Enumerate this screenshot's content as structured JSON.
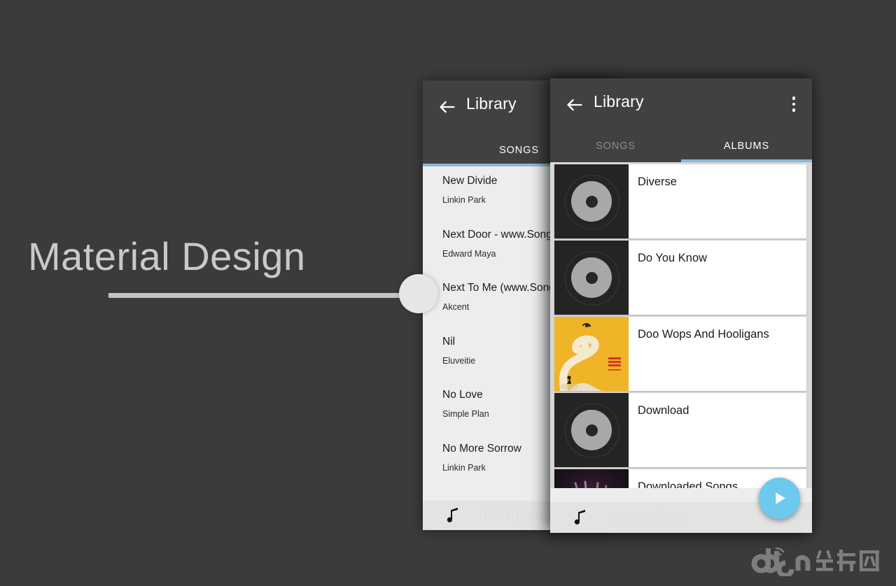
{
  "hero": {
    "title": "Material Design",
    "slider_name": "material-design-slider"
  },
  "screen_back": {
    "appbar": {
      "back_icon": "arrow-back-icon",
      "title": "Library"
    },
    "tabs": [
      {
        "label": "SONGS",
        "active": true
      }
    ],
    "songs": [
      {
        "title": "New Divide",
        "artist": "Linkin Park"
      },
      {
        "title": "Next Door - www.SongsLover",
        "artist": "Edward Maya"
      },
      {
        "title": "Next To Me (www.Songs.PK)",
        "artist": "Akcent"
      },
      {
        "title": "Nil",
        "artist": "Eluveitie"
      },
      {
        "title": "No Love",
        "artist": "Simple Plan"
      },
      {
        "title": "No More Sorrow",
        "artist": "Linkin Park"
      }
    ],
    "nowplaying": {
      "icon": "music-note-icon",
      "label": "One Step Close"
    }
  },
  "screen_front": {
    "appbar": {
      "back_icon": "arrow-back-icon",
      "title": "Library",
      "overflow_icon": "more-vertical-icon"
    },
    "tabs": [
      {
        "label": "SONGS",
        "active": false
      },
      {
        "label": "ALBUMS",
        "active": true
      }
    ],
    "albums": [
      {
        "title": "Diverse",
        "art": "vinyl"
      },
      {
        "title": "Do You Know",
        "art": "vinyl"
      },
      {
        "title": "Doo Wops And Hooligans",
        "art": "doowops"
      },
      {
        "title": "Download",
        "art": "vinyl"
      },
      {
        "title": "Downloaded Songs",
        "art": "downloaded"
      }
    ],
    "nowplaying": {
      "icon": "music-note-icon",
      "label": "One Step Closer"
    },
    "fab": {
      "icon": "play-icon",
      "color": "#6ec9ef"
    }
  },
  "watermark": {
    "text": "d.cn 当乐网"
  },
  "colors": {
    "background": "#3b3b3b",
    "appbar": "#414141",
    "tab_indicator": "#8bb9d4",
    "fab": "#6ec9ef",
    "list_background": "#eceded",
    "album_background": "#d9d9d9"
  }
}
